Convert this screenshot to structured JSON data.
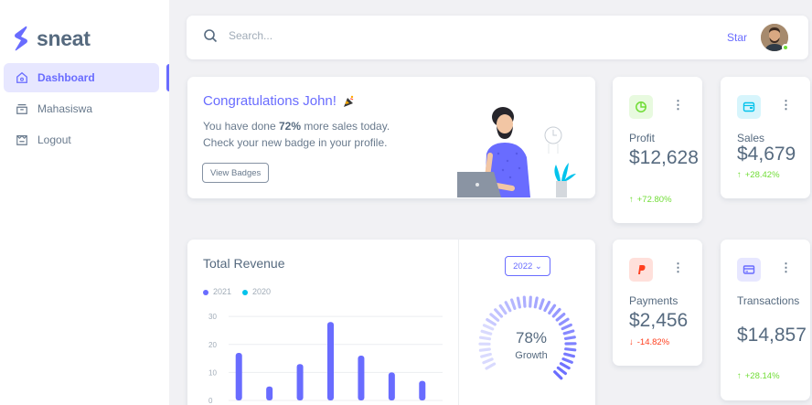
{
  "brand": {
    "name": "sneat",
    "color": "#696cff"
  },
  "sidebar": {
    "items": [
      {
        "label": "Dashboard",
        "icon": "home-icon",
        "active": true
      },
      {
        "label": "Mahasiswa",
        "icon": "archive-icon",
        "active": false
      },
      {
        "label": "Logout",
        "icon": "logout-icon",
        "active": false
      }
    ]
  },
  "navbar": {
    "search_placeholder": "Search...",
    "star_label": "Star",
    "avatar_icon": "user-avatar"
  },
  "congrats": {
    "title": "Congratulations John!",
    "title_icon": "party-popper-icon",
    "text_before": "You have done ",
    "text_bold": "72%",
    "text_after": " more sales today.",
    "text_line2": "Check your new badge in your profile.",
    "button": "View Badges"
  },
  "stats": {
    "profit": {
      "label": "Profit",
      "value": "$12,628",
      "change": "+72.80%",
      "direction": "up",
      "icon": "chart-pie-icon",
      "icon_color": "#71dd37",
      "icon_bg": "#e8fadf"
    },
    "sales": {
      "label": "Sales",
      "value": "$4,679",
      "change": "+28.42%",
      "direction": "up",
      "icon": "wallet-icon",
      "icon_color": "#03c3ec",
      "icon_bg": "#d7f5fc"
    },
    "payments": {
      "label": "Payments",
      "value": "$2,456",
      "change": "-14.82%",
      "direction": "down",
      "icon": "paypal-icon",
      "icon_color": "#ff3e1d",
      "icon_bg": "#ffe0db"
    },
    "transactions": {
      "label": "Transactions",
      "value": "$14,857",
      "change": "+28.14%",
      "direction": "up",
      "icon": "credit-card-icon",
      "icon_color": "#696cff",
      "icon_bg": "#e7e7ff"
    }
  },
  "revenue": {
    "title": "Total Revenue",
    "year_select": "2022",
    "growth_pct": "78%",
    "growth_label": "Growth",
    "growth_value": 0.78
  },
  "chart_data": {
    "type": "bar",
    "title": "Total Revenue",
    "series": [
      {
        "name": "2021",
        "color": "#696cff",
        "values": [
          17,
          5,
          13,
          28,
          16,
          10,
          7
        ]
      },
      {
        "name": "2020",
        "color": "#03c3ec",
        "values": []
      }
    ],
    "yticks": [
      0,
      10,
      20,
      30
    ],
    "ylim": [
      0,
      32
    ],
    "grid": true,
    "legend_placement": "top-left"
  }
}
